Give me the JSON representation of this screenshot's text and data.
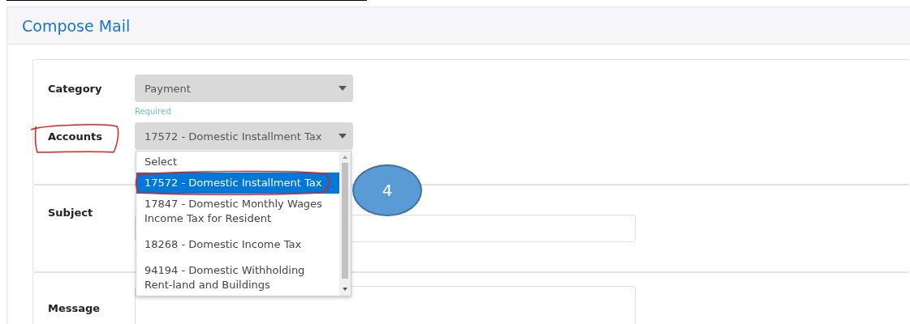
{
  "panel": {
    "title": "Compose Mail"
  },
  "category": {
    "label": "Category",
    "value": "Payment",
    "hint": "Required"
  },
  "accounts": {
    "label": "Accounts",
    "value": "17572 - Domestic Installment Tax",
    "expanded": true,
    "options": [
      {
        "text": "Select",
        "selected": false
      },
      {
        "text": "17572 - Domestic Installment Tax",
        "selected": true
      },
      {
        "text": "17847 - Domestic Monthly Wages Income Tax for Resident",
        "selected": false
      },
      {
        "text": "18268 - Domestic Income Tax",
        "selected": false
      },
      {
        "text": "94194 - Domestic Withholding Rent-land and Buildings",
        "selected": false
      }
    ]
  },
  "subject": {
    "label": "Subject"
  },
  "message": {
    "label": "Message"
  },
  "callout": {
    "text": "4"
  }
}
